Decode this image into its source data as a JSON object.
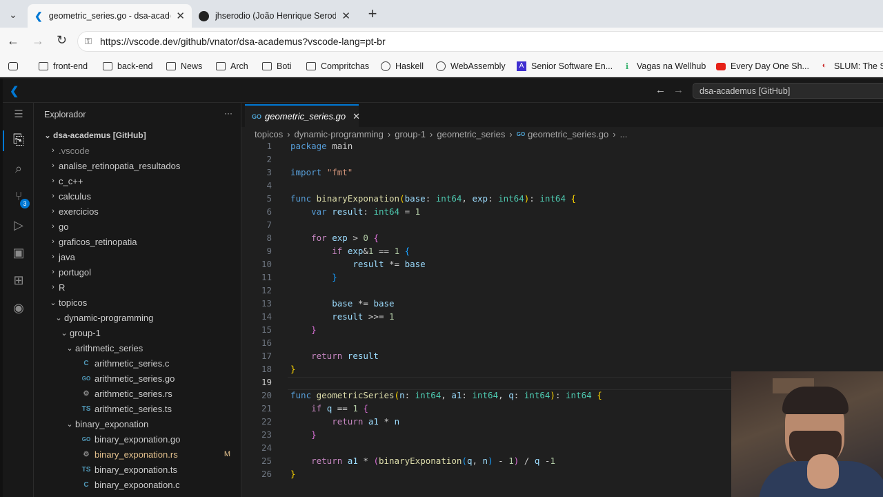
{
  "browser": {
    "tabs": [
      {
        "title": "geometric_series.go - dsa-academus",
        "active": true
      },
      {
        "title": "jhserodio (João Henrique Serodio)",
        "active": false
      }
    ],
    "new_tab": "+",
    "url": "https://vscode.dev/github/vnator/dsa-academus?vscode-lang=pt-br",
    "bookmarks": [
      "front-end",
      "back-end",
      "News",
      "Arch",
      "Boti",
      "Compritchas",
      "Haskell",
      "WebAssembly",
      "Senior Software En...",
      "Vagas na Wellhub",
      "Every Day One Sh...",
      "SLUM: The Sl"
    ]
  },
  "vscode": {
    "command_center": "dsa-academus [GitHub]",
    "scm_badge": "3",
    "explorer_title": "Explorador",
    "explorer_more": "···",
    "root": "dsa-academus [GitHub]",
    "tree": [
      {
        "label": ".vscode",
        "depth": 0,
        "chev": "›",
        "icon": ""
      },
      {
        "label": "analise_retinopatia_resultados",
        "depth": 0,
        "chev": "›",
        "icon": ""
      },
      {
        "label": "c_c++",
        "depth": 0,
        "chev": "›",
        "icon": ""
      },
      {
        "label": "calculus",
        "depth": 0,
        "chev": "›",
        "icon": ""
      },
      {
        "label": "exercicios",
        "depth": 0,
        "chev": "›",
        "icon": ""
      },
      {
        "label": "go",
        "depth": 0,
        "chev": "›",
        "icon": ""
      },
      {
        "label": "graficos_retinopatia",
        "depth": 0,
        "chev": "›",
        "icon": ""
      },
      {
        "label": "java",
        "depth": 0,
        "chev": "›",
        "icon": ""
      },
      {
        "label": "portugol",
        "depth": 0,
        "chev": "›",
        "icon": ""
      },
      {
        "label": "R",
        "depth": 0,
        "chev": "›",
        "icon": ""
      },
      {
        "label": "topicos",
        "depth": 0,
        "chev": "⌄",
        "icon": ""
      },
      {
        "label": "dynamic-programming",
        "depth": 1,
        "chev": "⌄",
        "icon": ""
      },
      {
        "label": "group-1",
        "depth": 2,
        "chev": "⌄",
        "icon": ""
      },
      {
        "label": "arithmetic_series",
        "depth": 3,
        "chev": "⌄",
        "icon": ""
      },
      {
        "label": "arithmetic_series.c",
        "depth": 4,
        "chev": "",
        "icon": "C"
      },
      {
        "label": "arithmetic_series.go",
        "depth": 4,
        "chev": "",
        "icon": "GO"
      },
      {
        "label": "arithmetic_series.rs",
        "depth": 4,
        "chev": "",
        "icon": "⚙"
      },
      {
        "label": "arithmetic_series.ts",
        "depth": 4,
        "chev": "",
        "icon": "TS"
      },
      {
        "label": "binary_exponation",
        "depth": 3,
        "chev": "⌄",
        "icon": ""
      },
      {
        "label": "binary_exponation.go",
        "depth": 4,
        "chev": "",
        "icon": "GO"
      },
      {
        "label": "binary_exponation.rs",
        "depth": 4,
        "chev": "",
        "icon": "⚙",
        "modified": "M"
      },
      {
        "label": "binary_exponation.ts",
        "depth": 4,
        "chev": "",
        "icon": "TS"
      },
      {
        "label": "binary_expoonation.c",
        "depth": 4,
        "chev": "",
        "icon": "C"
      }
    ],
    "editor_tab": "geometric_series.go",
    "editor_tab_icon": "GO",
    "breadcrumb": [
      "topicos",
      "dynamic-programming",
      "group-1",
      "geometric_series",
      "geometric_series.go",
      "..."
    ],
    "code_lines": [
      [
        [
          "kw",
          "package"
        ],
        [
          "",
          "main"
        ]
      ],
      [],
      [
        [
          "kw",
          "import"
        ],
        [
          "",
          ""
        ],
        [
          "st",
          "\"fmt\""
        ]
      ],
      [],
      [
        [
          "kw",
          "func"
        ],
        [
          "fn",
          "binaryExponation"
        ],
        [
          "pu",
          "("
        ],
        [
          "va",
          "base"
        ],
        [
          "",
          ": "
        ],
        [
          "ty",
          "int64"
        ],
        [
          "",
          ", "
        ],
        [
          "va",
          "exp"
        ],
        [
          "",
          ": "
        ],
        [
          "ty",
          "int64"
        ],
        [
          "pu",
          ")"
        ],
        [
          "",
          ": "
        ],
        [
          "ty",
          "int64"
        ],
        [
          "",
          ""
        ],
        [
          "pu",
          "{"
        ]
      ],
      [
        [
          "",
          "    "
        ],
        [
          "kw",
          "var"
        ],
        [
          "",
          ""
        ],
        [
          "va",
          "result"
        ],
        [
          "",
          ": "
        ],
        [
          "ty",
          "int64"
        ],
        [
          "",
          ""
        ],
        [
          "",
          "="
        ],
        [
          "",
          ""
        ],
        [
          "nu",
          "1"
        ]
      ],
      [],
      [
        [
          "",
          "    "
        ],
        [
          "k2",
          "for"
        ],
        [
          "",
          ""
        ],
        [
          "va",
          "exp"
        ],
        [
          "",
          ""
        ],
        [
          "",
          ">"
        ],
        [
          "",
          ""
        ],
        [
          "nu",
          "0"
        ],
        [
          "",
          ""
        ],
        [
          "pp",
          "{"
        ]
      ],
      [
        [
          "",
          "        "
        ],
        [
          "k2",
          "if"
        ],
        [
          "",
          ""
        ],
        [
          "va",
          "exp"
        ],
        [
          "",
          "&"
        ],
        [
          "nu",
          "1"
        ],
        [
          "",
          ""
        ],
        [
          "",
          "=="
        ],
        [
          "",
          ""
        ],
        [
          "nu",
          "1"
        ],
        [
          "",
          ""
        ],
        [
          "pb",
          "{"
        ]
      ],
      [
        [
          "",
          "            "
        ],
        [
          "va",
          "result"
        ],
        [
          "",
          ""
        ],
        [
          "",
          "*="
        ],
        [
          "",
          ""
        ],
        [
          "va",
          "base"
        ]
      ],
      [
        [
          "",
          "        "
        ],
        [
          "pb",
          "}"
        ]
      ],
      [],
      [
        [
          "",
          "        "
        ],
        [
          "va",
          "base"
        ],
        [
          "",
          ""
        ],
        [
          "",
          "*="
        ],
        [
          "",
          ""
        ],
        [
          "va",
          "base"
        ]
      ],
      [
        [
          "",
          "        "
        ],
        [
          "va",
          "result"
        ],
        [
          "",
          ""
        ],
        [
          "",
          ">>="
        ],
        [
          "",
          ""
        ],
        [
          "nu",
          "1"
        ]
      ],
      [
        [
          "",
          "    "
        ],
        [
          "pp",
          "}"
        ]
      ],
      [],
      [
        [
          "",
          "    "
        ],
        [
          "k2",
          "return"
        ],
        [
          "",
          ""
        ],
        [
          "va",
          "result"
        ]
      ],
      [
        [
          "pu",
          "}"
        ]
      ],
      [],
      [
        [
          "kw",
          "func"
        ],
        [
          "fn",
          "geometricSeries"
        ],
        [
          "pu",
          "("
        ],
        [
          "va",
          "n"
        ],
        [
          "",
          ": "
        ],
        [
          "ty",
          "int64"
        ],
        [
          "",
          ", "
        ],
        [
          "va",
          "a1"
        ],
        [
          "",
          ": "
        ],
        [
          "ty",
          "int64"
        ],
        [
          "",
          ", "
        ],
        [
          "va",
          "q"
        ],
        [
          "",
          ": "
        ],
        [
          "ty",
          "int64"
        ],
        [
          "pu",
          ")"
        ],
        [
          "",
          ": "
        ],
        [
          "ty",
          "int64"
        ],
        [
          "",
          ""
        ],
        [
          "pu",
          "{"
        ]
      ],
      [
        [
          "",
          "    "
        ],
        [
          "k2",
          "if"
        ],
        [
          "",
          ""
        ],
        [
          "va",
          "q"
        ],
        [
          "",
          ""
        ],
        [
          "",
          "=="
        ],
        [
          "",
          ""
        ],
        [
          "nu",
          "1"
        ],
        [
          "",
          ""
        ],
        [
          "pp",
          "{"
        ]
      ],
      [
        [
          "",
          "        "
        ],
        [
          "k2",
          "return"
        ],
        [
          "",
          ""
        ],
        [
          "va",
          "a1"
        ],
        [
          "",
          ""
        ],
        [
          "",
          "*"
        ],
        [
          "",
          ""
        ],
        [
          "va",
          "n"
        ]
      ],
      [
        [
          "",
          "    "
        ],
        [
          "pp",
          "}"
        ]
      ],
      [],
      [
        [
          "",
          "    "
        ],
        [
          "k2",
          "return"
        ],
        [
          "",
          ""
        ],
        [
          "va",
          "a1"
        ],
        [
          "",
          ""
        ],
        [
          "",
          "*"
        ],
        [
          "",
          ""
        ],
        [
          "pp",
          "("
        ],
        [
          "fn",
          "binaryExponation"
        ],
        [
          "pb",
          "("
        ],
        [
          "va",
          "q"
        ],
        [
          "",
          ", "
        ],
        [
          "va",
          "n"
        ],
        [
          "pb",
          ")"
        ],
        [
          "",
          ""
        ],
        [
          "",
          "-"
        ],
        [
          "",
          ""
        ],
        [
          "nu",
          "1"
        ],
        [
          "pp",
          ")"
        ],
        [
          "",
          ""
        ],
        [
          "",
          "/"
        ],
        [
          "",
          ""
        ],
        [
          "va",
          "q"
        ],
        [
          "",
          ""
        ],
        [
          "",
          "-"
        ],
        [
          "nu",
          "1"
        ]
      ],
      [
        [
          "pu",
          "}"
        ]
      ]
    ]
  }
}
